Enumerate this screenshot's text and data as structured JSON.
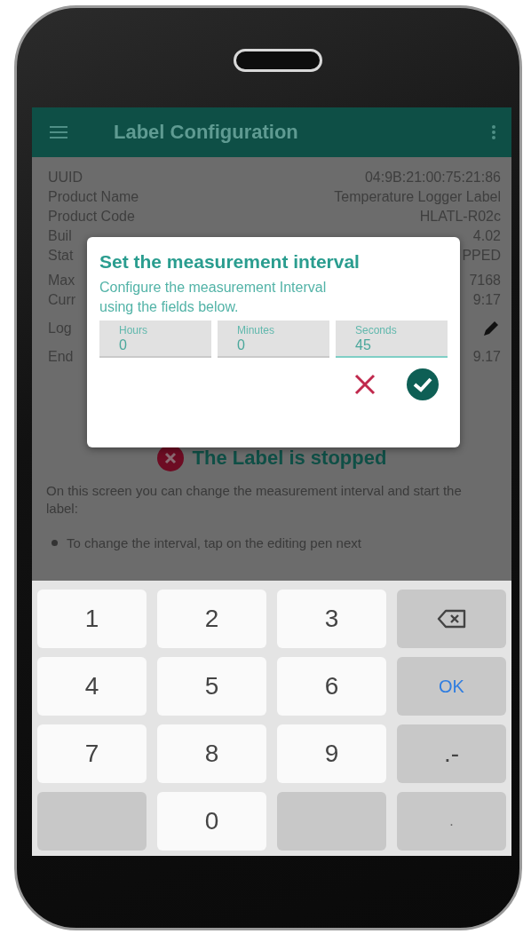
{
  "app_bar": {
    "title": "Label Configuration"
  },
  "info_rows": [
    {
      "label": "UUID",
      "value": "04:9B:21:00:75:21:86"
    },
    {
      "label": "Product Name",
      "value": "Temperature Logger Label"
    },
    {
      "label": "Product Code",
      "value": "HLATL-R02c"
    },
    {
      "label": "Buil",
      "value": "4.02"
    },
    {
      "label": "Stat",
      "value": "PPED"
    },
    {
      "label": "Max",
      "value": "7168",
      "kind": "gap"
    },
    {
      "label": "Curr",
      "value": "9:17"
    },
    {
      "label": "Log",
      "kind": "edit"
    },
    {
      "label": "End",
      "value": "9.17",
      "kind": "gap"
    }
  ],
  "dialog": {
    "title": "Set the measurement interval",
    "message": "Configure the measurement Interval using the fields below.",
    "fields": [
      {
        "label": "Hours",
        "value": "0",
        "focused": false
      },
      {
        "label": "Minutes",
        "value": "0",
        "focused": false
      },
      {
        "label": "Seconds",
        "value": "45",
        "focused": true
      }
    ]
  },
  "status": {
    "text": "The Label is stopped"
  },
  "intro": "On this screen you can change the measurement interval and start the label:",
  "bullets": [
    "To change the interval, tap on the editing pen next"
  ],
  "keyboard": [
    {
      "label": "1",
      "kind": "digit"
    },
    {
      "label": "2",
      "kind": "digit"
    },
    {
      "label": "3",
      "kind": "digit"
    },
    {
      "kind": "backspace"
    },
    {
      "label": "4",
      "kind": "digit"
    },
    {
      "label": "5",
      "kind": "digit"
    },
    {
      "label": "6",
      "kind": "digit"
    },
    {
      "label": "OK",
      "kind": "ok"
    },
    {
      "label": "7",
      "kind": "digit"
    },
    {
      "label": "8",
      "kind": "digit"
    },
    {
      "label": "9",
      "kind": "digit"
    },
    {
      "label": ".-",
      "kind": "action"
    },
    {
      "kind": "blank"
    },
    {
      "label": "0",
      "kind": "digit"
    },
    {
      "kind": "blank"
    },
    {
      "label": ".",
      "kind": "faint"
    }
  ]
}
